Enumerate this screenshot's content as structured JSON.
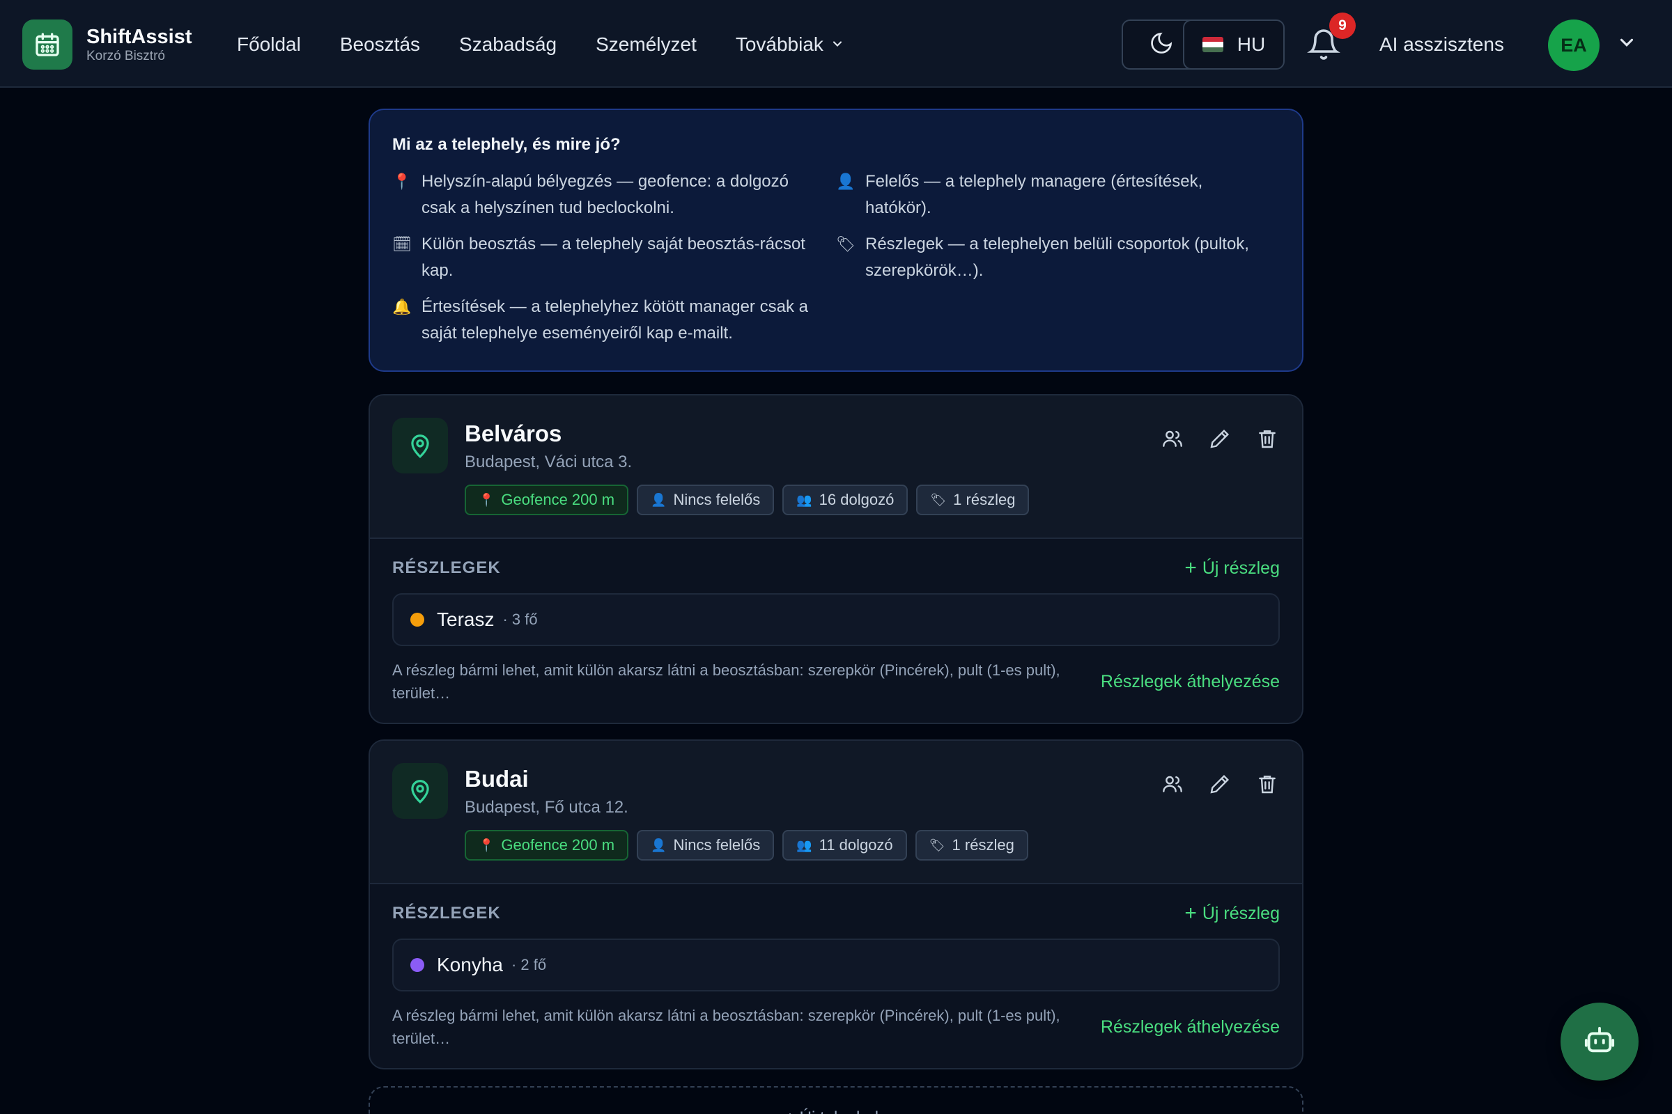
{
  "app": {
    "name": "ShiftAssist",
    "subtitle": "Korzó Bisztró",
    "icon": "calendar-icon",
    "accent": "#4ade80"
  },
  "nav": {
    "items": [
      {
        "label": "Főoldal"
      },
      {
        "label": "Beosztás"
      },
      {
        "label": "Szabadság"
      },
      {
        "label": "Személyzet"
      },
      {
        "label": "Továbbiak"
      }
    ]
  },
  "header": {
    "theme_icon": "moon-icon",
    "language": "HU",
    "notification_count": "9",
    "ai_label": "AI asszisztens",
    "avatar_initials": "EA"
  },
  "info": {
    "title": "Mi az a telephely, és mire jó?",
    "items_left": [
      {
        "icon": "📍",
        "text": "Helyszín-alapú bélyegzés — geofence: a dolgozó csak a helyszínen tud beclockolni."
      },
      {
        "icon": "🗓",
        "text": "Külön beosztás — a telephely saját beosztás-rácsot kap."
      },
      {
        "icon": "🔔",
        "text": "Értesítések — a telephelyhez kötött manager csak a saját telephelye eseményeiről kap e-mailt."
      }
    ],
    "items_right": [
      {
        "icon": "👤",
        "text": "Felelős — a telephely managere (értesítések, hatókör)."
      },
      {
        "icon": "🏷",
        "text": "Részlegek — a telephelyen belüli csoportok (pultok, szerepkörök…)."
      }
    ]
  },
  "locations": [
    {
      "name": "Belváros",
      "address": "Budapest, Váci utca 3.",
      "chips": {
        "geofence": "Geofence 200 m",
        "manager": "Nincs felelős",
        "staff": "16 dolgozó",
        "depts": "1 részleg"
      },
      "section_label": "RÉSZLEGEK",
      "new_dept": "Új részleg",
      "departments": [
        {
          "name": "Terasz",
          "count": "· 3 fő",
          "color": "#f59e0b"
        }
      ],
      "note": "A részleg bármi lehet, amit külön akarsz látni a beosztásban: szerepkör (Pincérek), pult (1-es pult), terület…",
      "move_link": "Részlegek áthelyezése"
    },
    {
      "name": "Budai",
      "address": "Budapest, Fő utca 12.",
      "chips": {
        "geofence": "Geofence 200 m",
        "manager": "Nincs felelős",
        "staff": "11 dolgozó",
        "depts": "1 részleg"
      },
      "section_label": "RÉSZLEGEK",
      "new_dept": "Új részleg",
      "departments": [
        {
          "name": "Konyha",
          "count": "· 2 fő",
          "color": "#8b5cf6"
        }
      ],
      "note": "A részleg bármi lehet, amit külön akarsz látni a beosztásban: szerepkör (Pincérek), pult (1-es pult), terület…",
      "move_link": "Részlegek áthelyezése"
    }
  ],
  "add_location": "+ Új telephely",
  "fab_icon": "robot-icon"
}
